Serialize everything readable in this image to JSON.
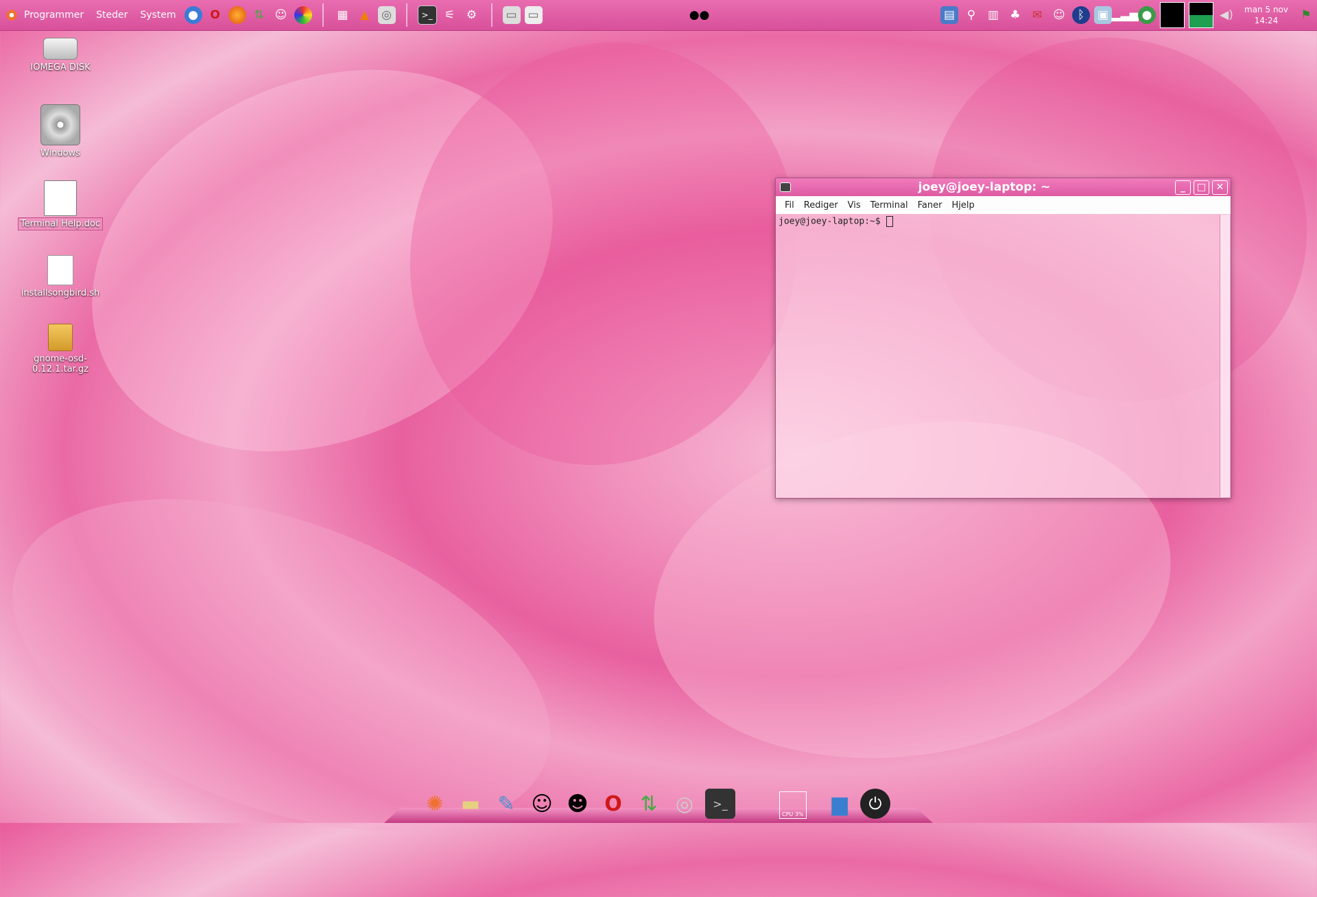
{
  "panel": {
    "menus": [
      "Programmer",
      "Steder",
      "System"
    ],
    "clock_day": "man  5 nov",
    "clock_time": "14:24"
  },
  "desktop": {
    "icons": [
      {
        "label": "IOMEGA DISK"
      },
      {
        "label": "Windows"
      },
      {
        "label": "Terminal Help.doc"
      },
      {
        "label": "installsongbird.sh"
      },
      {
        "label": "gnome-osd-0.12.1.tar.gz"
      }
    ]
  },
  "terminal": {
    "title": "joey@joey-laptop: ~",
    "menu": [
      "Fil",
      "Rediger",
      "Vis",
      "Terminal",
      "Faner",
      "Hjelp"
    ],
    "prompt": "joey@joey-laptop:~$"
  },
  "dock": {
    "cpu_label": "CPU 3%"
  },
  "colors": {
    "panel": "#e05aa5",
    "accent": "#de5aa2"
  }
}
